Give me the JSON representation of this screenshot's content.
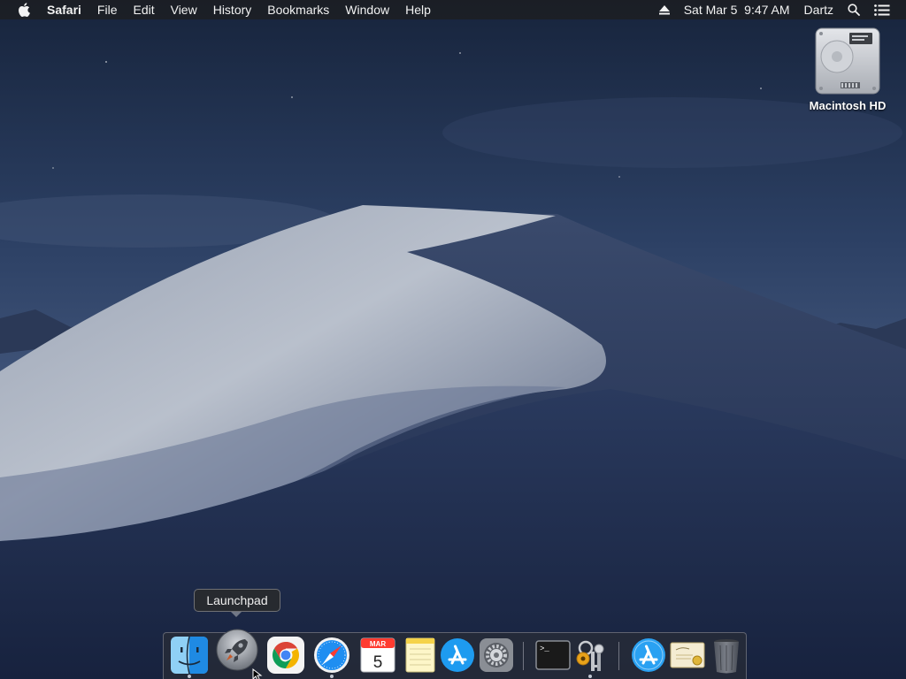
{
  "menubar": {
    "apple_icon": "apple-icon",
    "app_name": "Safari",
    "items": [
      "File",
      "Edit",
      "View",
      "History",
      "Bookmarks",
      "Window",
      "Help"
    ],
    "eject_icon": "eject-icon",
    "datetime": "Sat Mar 5  9:47 AM",
    "user": "Dartz",
    "search_icon": "spotlight-search-icon",
    "notifications_icon": "notification-center-icon"
  },
  "desktop": {
    "drive_label": "Macintosh HD",
    "drive_icon": "hard-drive-icon"
  },
  "tooltip": {
    "text": "Launchpad"
  },
  "dock": {
    "items": [
      {
        "name": "Finder",
        "icon": "finder-icon",
        "running": true
      },
      {
        "name": "Launchpad",
        "icon": "launchpad-rocket-icon",
        "running": false,
        "hovered": true
      },
      {
        "name": "Google Chrome",
        "icon": "chrome-icon",
        "running": false
      },
      {
        "name": "Safari",
        "icon": "safari-compass-icon",
        "running": true
      },
      {
        "name": "Calendar",
        "icon": "calendar-icon",
        "running": false,
        "month": "MAR",
        "day": "5"
      },
      {
        "name": "Notes",
        "icon": "notes-icon",
        "running": false
      },
      {
        "name": "App Store",
        "icon": "app-store-icon",
        "running": false
      },
      {
        "name": "System Preferences",
        "icon": "system-preferences-gear-icon",
        "running": false
      },
      {
        "name": "Terminal",
        "icon": "terminal-icon",
        "running": false,
        "prompt": ">_"
      },
      {
        "name": "Keychain Access",
        "icon": "keychain-access-icon",
        "running": true
      },
      {
        "name": "App Store Downloads",
        "icon": "app-store-icon",
        "running": false
      },
      {
        "name": "Certificate Assistant",
        "icon": "certificate-icon",
        "running": false
      },
      {
        "name": "Trash",
        "icon": "trash-icon",
        "running": false
      }
    ]
  },
  "colors": {
    "menubar_bg": "#1c1e24",
    "sky": "#2a3d5e",
    "dune_light": "#c7ccd6",
    "dock_bg": "#282c36"
  }
}
